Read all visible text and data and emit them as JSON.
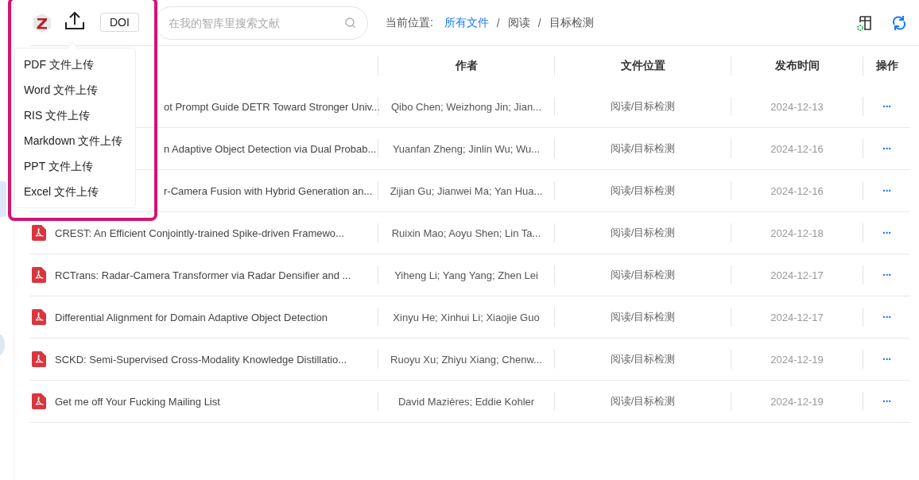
{
  "toolbar": {
    "doi_button": "DOI",
    "search": {
      "placeholder": "在我的智库里搜索文献"
    }
  },
  "breadcrumb": {
    "label": "当前位置:",
    "items": [
      {
        "text": "所有文件",
        "selected": true
      },
      {
        "text": "阅读",
        "selected": false
      },
      {
        "text": "目标检测",
        "selected": false
      }
    ],
    "separator": "/"
  },
  "upload_menu": [
    "PDF 文件上传",
    "Word 文件上传",
    "RIS 文件上传",
    "Markdown 文件上传",
    "PPT 文件上传",
    "Excel 文件上传"
  ],
  "table": {
    "columns": [
      "作者",
      "文件位置",
      "发布时间",
      "操作"
    ],
    "rows": [
      {
        "icon": false,
        "title": "ot Prompt Guide DETR Toward Stronger Univ...",
        "authors": "Qibo Chen; Weizhong Jin; Jian...",
        "location": "阅读/目标检测",
        "date": "2024-12-13",
        "action": "···"
      },
      {
        "icon": false,
        "title": "n Adaptive Object Detection via Dual Probab...",
        "authors": "Yuanfan Zheng; Jinlin Wu; Wu...",
        "location": "阅读/目标检测",
        "date": "2024-12-16",
        "action": "···"
      },
      {
        "icon": false,
        "title": "r-Camera Fusion with Hybrid Generation an...",
        "authors": "Zijian Gu; Jianwei Ma; Yan Hua...",
        "location": "阅读/目标检测",
        "date": "2024-12-16",
        "action": "···"
      },
      {
        "icon": true,
        "title": "CREST: An Efficient Conjointly-trained Spike-driven Framewo...",
        "authors": "Ruixin Mao; Aoyu Shen; Lin Ta...",
        "location": "阅读/目标检测",
        "date": "2024-12-18",
        "action": "···"
      },
      {
        "icon": true,
        "title": "RCTrans: Radar-Camera Transformer via Radar Densifier and ...",
        "authors": "Yiheng Li; Yang Yang; Zhen Lei",
        "location": "阅读/目标检测",
        "date": "2024-12-17",
        "action": "···"
      },
      {
        "icon": true,
        "title": "Differential Alignment for Domain Adaptive Object Detection",
        "authors": "Xinyu He; Xinhui Li; Xiaojie Guo",
        "location": "阅读/目标检测",
        "date": "2024-12-17",
        "action": "···"
      },
      {
        "icon": true,
        "title": "SCKD: Semi-Supervised Cross-Modality Knowledge Distillatio...",
        "authors": "Ruoyu Xu; Zhiyu Xiang; Chenw...",
        "location": "阅读/目标检测",
        "date": "2024-12-19",
        "action": "···"
      },
      {
        "icon": true,
        "title": "Get me off Your Fucking Mailing List",
        "authors": "David Mazières; Eddie Kohler",
        "location": "阅读/目标检测",
        "date": "2024-12-19",
        "action": "···"
      }
    ]
  }
}
